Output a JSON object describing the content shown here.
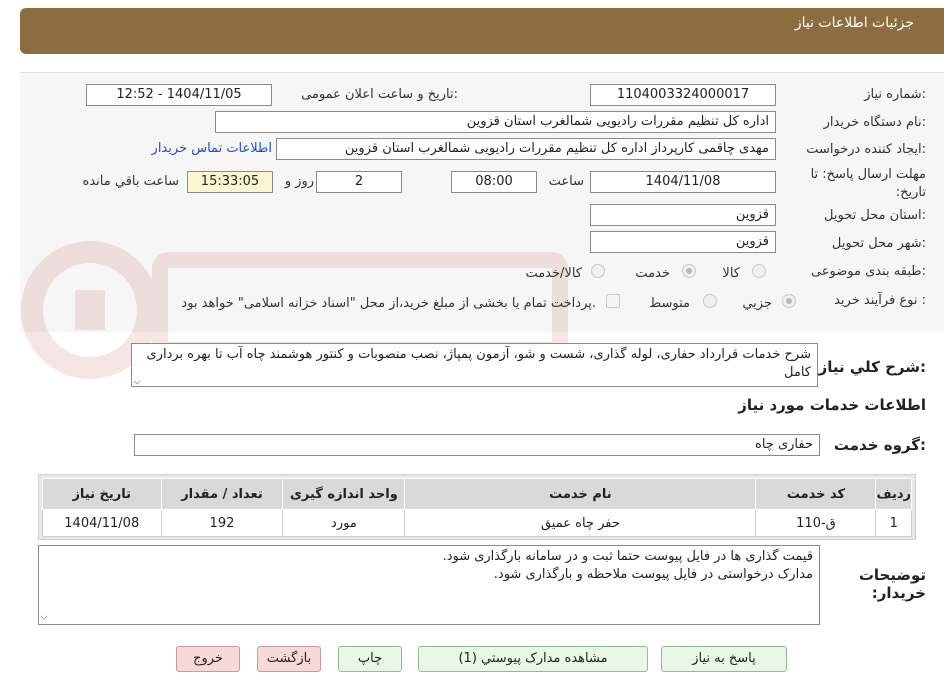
{
  "header": {
    "title": "جزئیات اطلاعات نیاز"
  },
  "form": {
    "need_number_label": "شماره نیاز:",
    "need_number": "1104003324000017",
    "announce_label": "تاریخ و ساعت اعلان عمومی:",
    "announce_value": "1404/11/05 - 12:52",
    "buyer_org_label": "نام دستگاه خریدار:",
    "buyer_org": "اداره کل تنظیم مقررات رادیویی شمالغرب استان قزوین",
    "requester_label": "ایجاد کننده درخواست:",
    "requester": "مهدی  چاقمی کارپرداز اداره کل تنظیم مقررات رادیویی شمالغرب استان قزوین",
    "contact_link": "اطلاعات تماس خریدار",
    "deadline_label": "مهلت ارسال پاسخ: تا تاریخ:",
    "deadline_date": "1404/11/08",
    "time_label": "ساعت",
    "deadline_time": "08:00",
    "days_value": "2",
    "days_label": "روز و",
    "remaining_time": "15:33:05",
    "remaining_label": "ساعت باقي مانده",
    "province_label": "استان محل تحویل:",
    "province": "قزوین",
    "city_label": "شهر محل تحویل:",
    "city": "قزوین",
    "category_label": "طبقه بندی موضوعی:",
    "category_options": {
      "goods": "کالا",
      "service": "خدمت",
      "goods_service": "کالا/خدمت"
    },
    "process_label": "نوع فرآیند خرید :",
    "process_options": {
      "partial": "جزيي",
      "medium": "متوسط"
    },
    "payment_note": "پرداخت تمام یا بخشی از مبلغ خرید،از محل \"اسناد خزانه اسلامی\" خواهد بود."
  },
  "description": {
    "label": "شرح کلي نياز:",
    "text": "شرح خدمات قرارداد حفاری، لوله گذاری، شست و شو،  آزمون پمپاژ، نصب منصوبات و کنتور هوشمند چاه آب تا بهره برداری کامل"
  },
  "services": {
    "section_title": "اطلاعات خدمات مورد نیاز",
    "group_label": "گروه خدمت:",
    "group_value": "حفاری چاه",
    "columns": [
      "ردیف",
      "کد خدمت",
      "نام خدمت",
      "واحد اندازه گیری",
      "تعداد / مقدار",
      "تاریخ نیاز"
    ],
    "rows": [
      [
        "1",
        "ق-110",
        "حفر چاه عمیق",
        "مورد",
        "192",
        "1404/11/08"
      ]
    ]
  },
  "buyer_notes": {
    "label": "توضیحات خریدار:",
    "line1": "قیمت گذاری ها در فایل پیوست حتما ثبت و در سامانه بارگذاری شود.",
    "line2": "مدارک درخواستی در فایل پیوست ملاحظه و بارگذاری شود."
  },
  "buttons": {
    "reply": "پاسخ به نیاز",
    "attachments": "مشاهده مدارک پیوستي (1)",
    "print": "چاپ",
    "back": "بازگشت",
    "exit": "خروج"
  },
  "colors": {
    "header_bg": "#8c6d3f",
    "link": "#1a4fcf",
    "remaining_bg": "#fbf6d2"
  }
}
